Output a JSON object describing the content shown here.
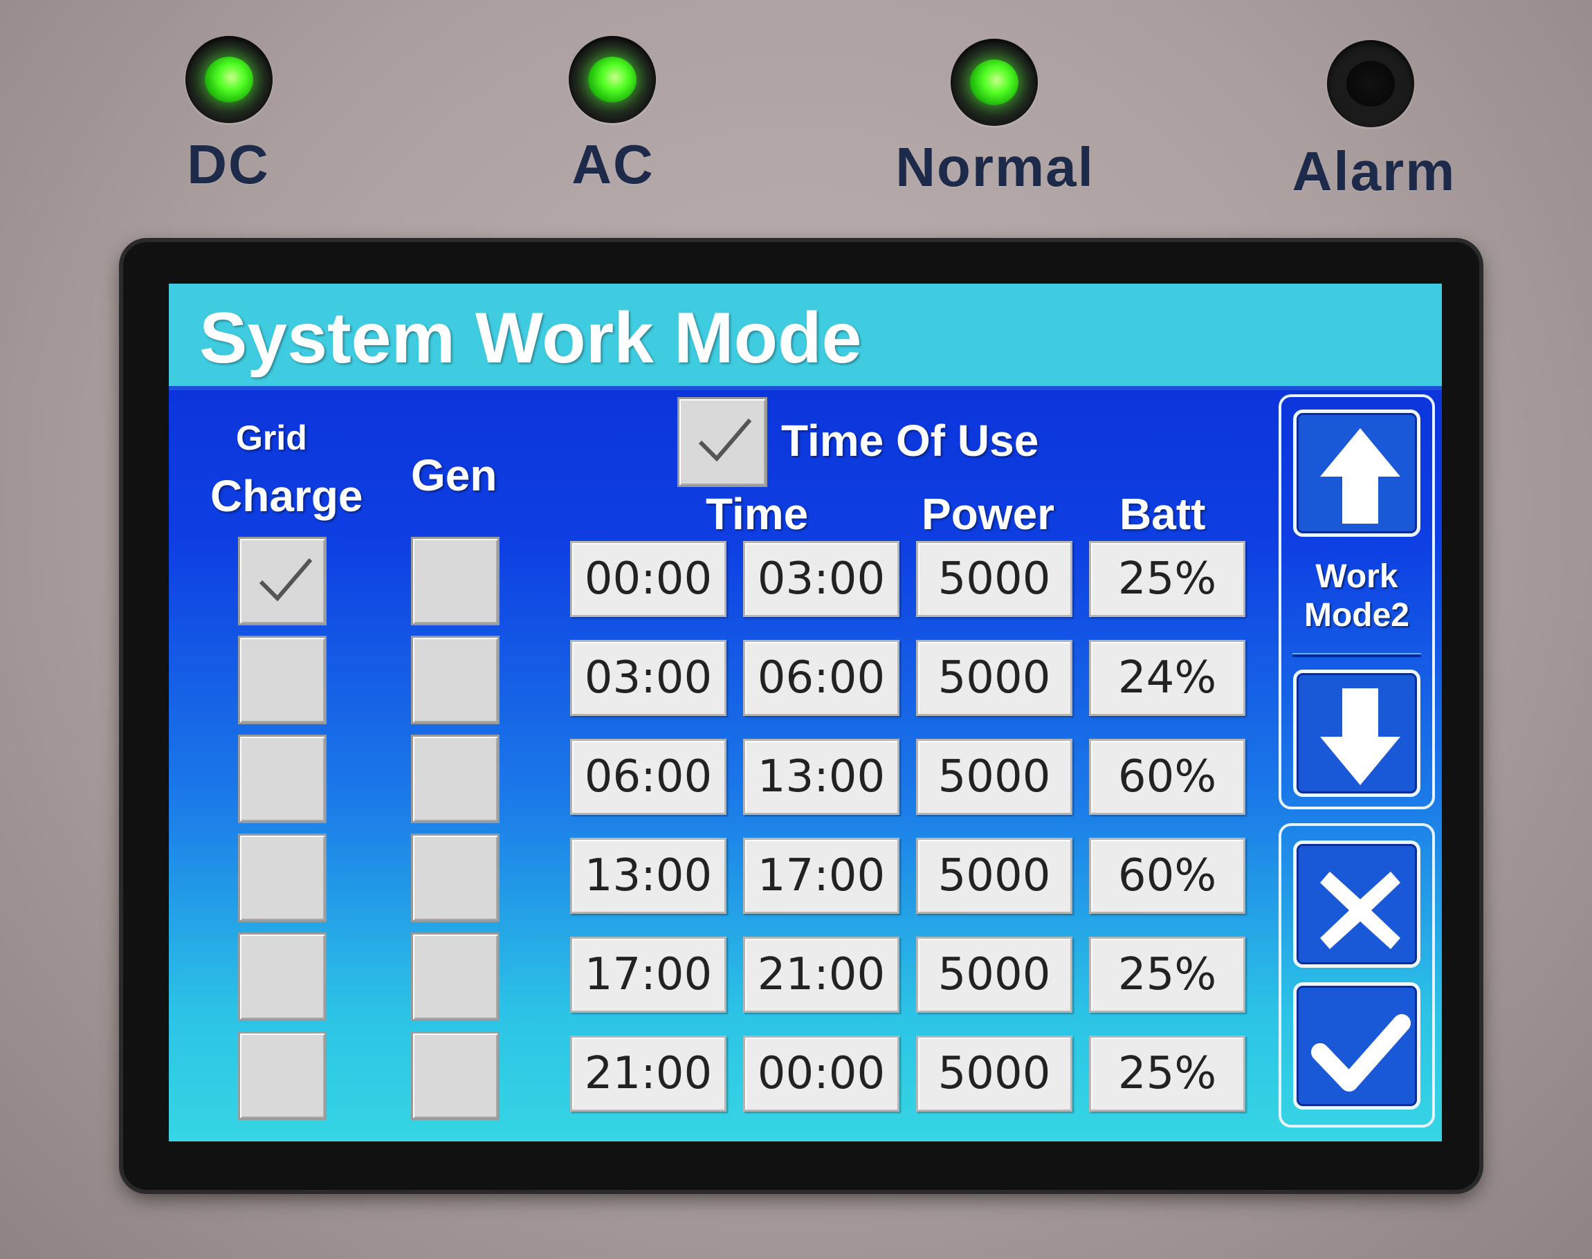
{
  "leds": [
    {
      "label": "DC",
      "state": "on"
    },
    {
      "label": "AC",
      "state": "on"
    },
    {
      "label": "Normal",
      "state": "on"
    },
    {
      "label": "Alarm",
      "state": "off"
    }
  ],
  "screen": {
    "title": "System Work Mode",
    "grid_charge_header_line1": "Grid",
    "grid_charge_header_line2": "Charge",
    "gen_header": "Gen",
    "time_of_use_label": "Time Of Use",
    "time_of_use_checked": true,
    "col_time": "Time",
    "col_power": "Power",
    "col_batt": "Batt",
    "rows": [
      {
        "grid_charge": true,
        "gen": false,
        "start": "00:00",
        "end": "03:00",
        "power": "5000",
        "batt": "25%"
      },
      {
        "grid_charge": false,
        "gen": false,
        "start": "03:00",
        "end": "06:00",
        "power": "5000",
        "batt": "24%"
      },
      {
        "grid_charge": false,
        "gen": false,
        "start": "06:00",
        "end": "13:00",
        "power": "5000",
        "batt": "60%"
      },
      {
        "grid_charge": false,
        "gen": false,
        "start": "13:00",
        "end": "17:00",
        "power": "5000",
        "batt": "60%"
      },
      {
        "grid_charge": false,
        "gen": false,
        "start": "17:00",
        "end": "21:00",
        "power": "5000",
        "batt": "25%"
      },
      {
        "grid_charge": false,
        "gen": false,
        "start": "21:00",
        "end": "00:00",
        "power": "5000",
        "batt": "25%"
      }
    ],
    "work_mode_line1": "Work",
    "work_mode_line2": "Mode2"
  },
  "colors": {
    "led_on": "#52ff24",
    "screen_blue": "#0e3fe3",
    "screen_cyan": "#36d6e4",
    "title_bar": "#3fcbe0",
    "label_navy": "#1d2a4a"
  },
  "icons": [
    "arrow-up-icon",
    "arrow-down-icon",
    "cancel-x-icon",
    "confirm-check-icon",
    "checkmark-icon"
  ]
}
